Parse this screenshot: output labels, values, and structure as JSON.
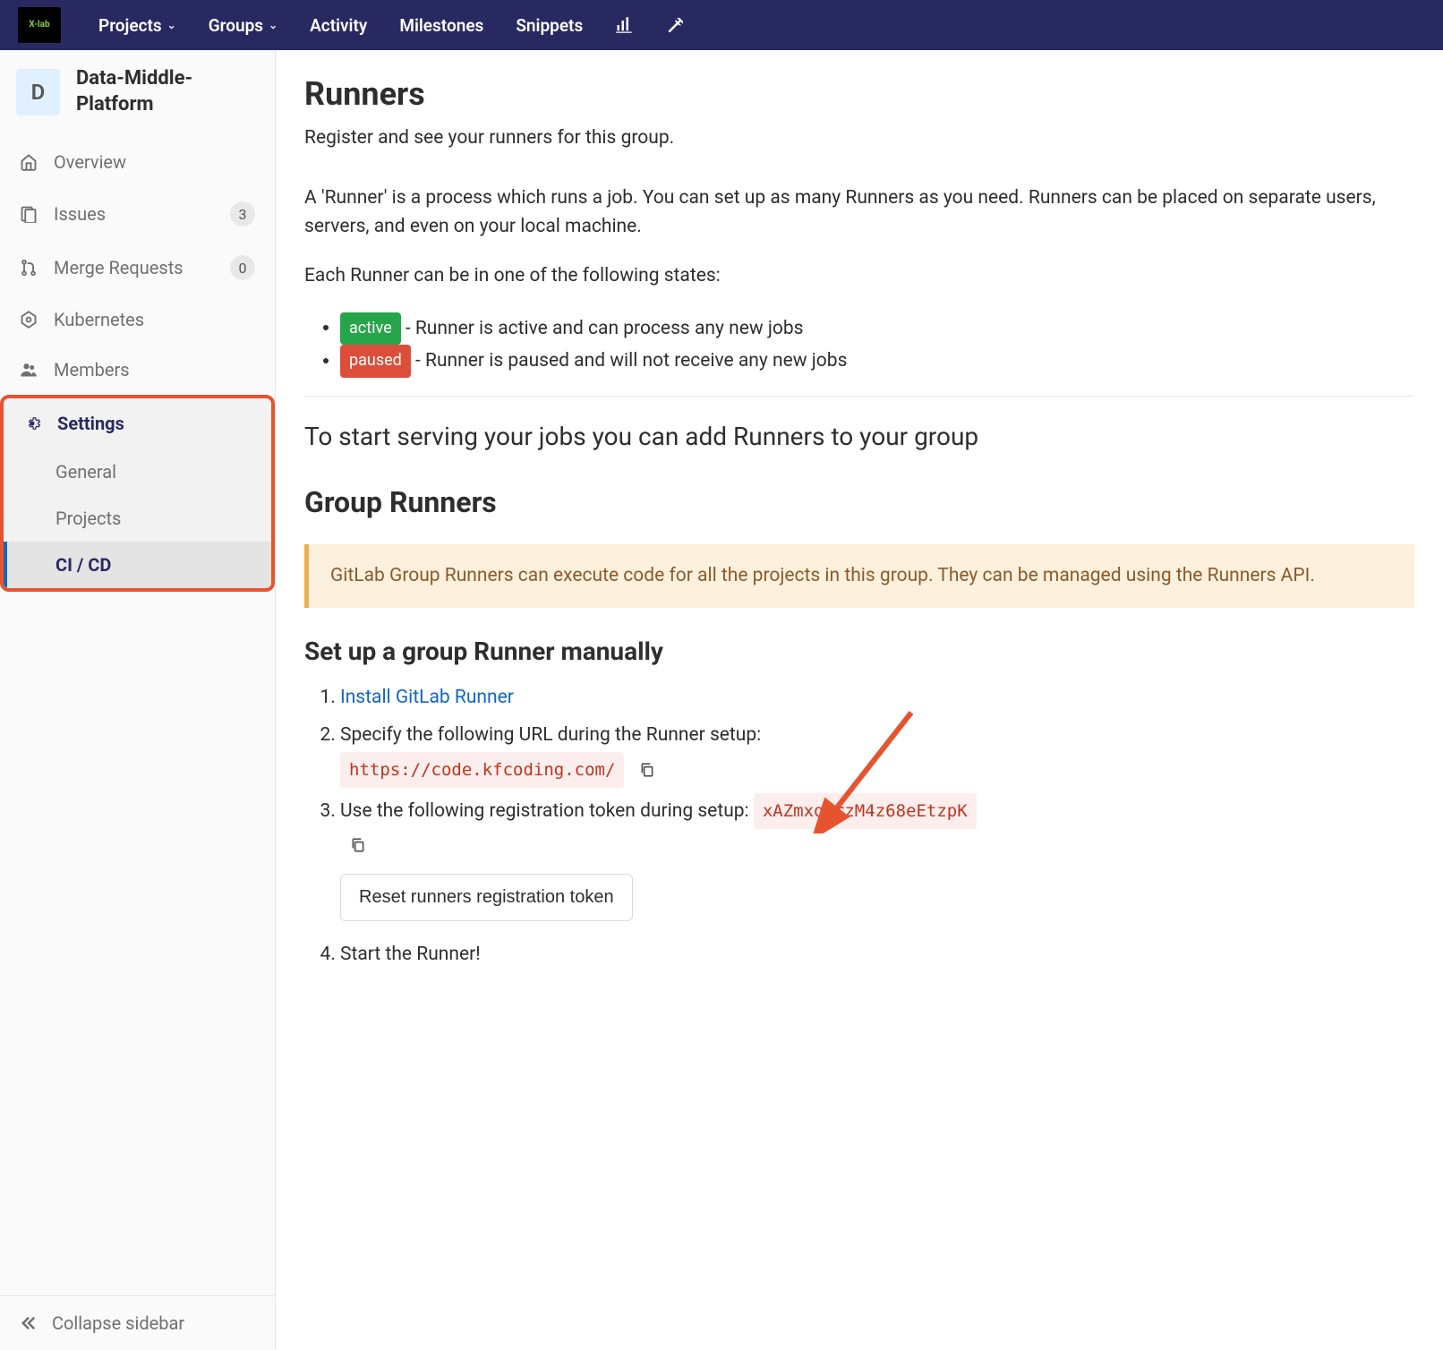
{
  "topnav": {
    "logo_text": "X-lab",
    "items": [
      {
        "label": "Projects",
        "caret": true
      },
      {
        "label": "Groups",
        "caret": true
      },
      {
        "label": "Activity",
        "caret": false
      },
      {
        "label": "Milestones",
        "caret": false
      },
      {
        "label": "Snippets",
        "caret": false
      }
    ]
  },
  "sidebar": {
    "project_avatar_letter": "D",
    "project_name": "Data-Middle-Platform",
    "overview": "Overview",
    "issues": "Issues",
    "issues_count": "3",
    "merge_requests": "Merge Requests",
    "merge_requests_count": "0",
    "kubernetes": "Kubernetes",
    "members": "Members",
    "settings": "Settings",
    "sub_general": "General",
    "sub_projects": "Projects",
    "sub_cicd": "CI / CD",
    "collapse": "Collapse sidebar"
  },
  "main": {
    "title": "Runners",
    "subtitle": "Register and see your runners for this group.",
    "desc": "A 'Runner' is a process which runs a job. You can set up as many Runners as you need. Runners can be placed on separate users, servers, and even on your local machine.",
    "states_intro": "Each Runner can be in one of the following states:",
    "active_label": "active",
    "active_desc": " - Runner is active and can process any new jobs",
    "paused_label": "paused",
    "paused_desc": " - Runner is paused and will not receive any new jobs",
    "start_heading": "To start serving your jobs you can add Runners to your group",
    "group_runners_heading": "Group Runners",
    "callout": "GitLab Group Runners can execute code for all the projects in this group. They can be managed using the Runners API.",
    "setup_heading": "Set up a group Runner manually",
    "step1_link": "Install GitLab Runner",
    "step2_text": "Specify the following URL during the Runner setup:",
    "step2_url": "https://code.kfcoding.com/",
    "step3_text": "Use the following registration token during setup: ",
    "step3_token": "xAZmxqsrzM4z68eEtzpK",
    "reset_btn": "Reset runners registration token",
    "step4_text": "Start the Runner!"
  }
}
